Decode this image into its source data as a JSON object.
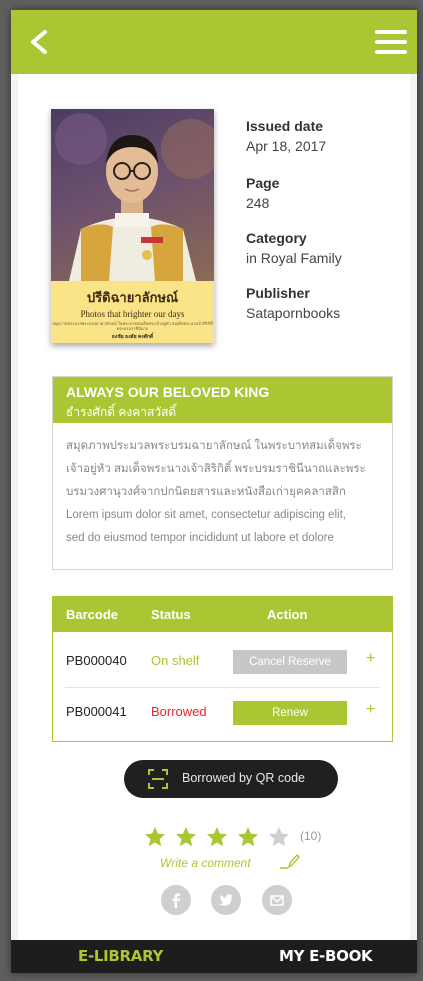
{
  "header": {
    "back_icon": "chevron-left-icon",
    "menu_icon": "hamburger-menu-icon",
    "accent_color": "#aac733"
  },
  "book": {
    "cover": {
      "title": "ปรีดิฉายาลักษณ์",
      "subtitle": "Photos that brighter our days",
      "small_text": "สมุดภาพประมวลพระบรมฉายาลักษณ์ ในพระบาทสมเด็จพระเจ้าอยู่หัว สมเด็จพระนางเจ้าสิริกิติ์ พระบรมราชินีนาถ",
      "author": "ธงชัย ธงสัย คงศักดิ์"
    },
    "meta": [
      {
        "label": "Issued date",
        "value": "Apr 18, 2017"
      },
      {
        "label": "Page",
        "value": "248"
      },
      {
        "label": "Category",
        "value": "in Royal Family"
      },
      {
        "label": "Publisher",
        "value": "Satapornbooks"
      }
    ]
  },
  "description": {
    "title": "ALWAYS OUR BELOVED KING",
    "author": "ธำรงศักดิ์ คงคาสวัสดิ์",
    "lines": [
      "สมุดภาพประมวลพระบรมฉายาลักษณ์ ในพระบาทสมเด็จพระ",
      "เจ้าอยู่หัว  สมเด็จพระนางเจ้าสิริกิติ์ พระบรมราชินีนาถและพระ",
      "บรมวงศานุวงศ์จากปกนิตยสารและหนังสือเก่ายุคคลาสสิก",
      "Lorem ipsum dolor sit amet, consectetur adipiscing elit,",
      "sed do eiusmod tempor incididunt ut labore et dolore"
    ]
  },
  "copies": {
    "headers": {
      "barcode": "Barcode",
      "status": "Status",
      "action": "Action"
    },
    "rows": [
      {
        "barcode": "PB000040",
        "status": "On shelf",
        "status_color": "#aac733",
        "action": "Cancel  Reserve",
        "action_color": "#c7c7c7",
        "plus": "+"
      },
      {
        "barcode": "PB000041",
        "status": "Borrowed",
        "status_color": "#e8262d",
        "action": "Renew",
        "action_color": "#aac733",
        "plus": "+"
      }
    ]
  },
  "qr": {
    "label": "Borrowed by QR code",
    "icon": "qr-scan-icon"
  },
  "rating": {
    "stars_filled": 4,
    "stars_total": 5,
    "count": "(10)",
    "comment": "Write a comment",
    "filled_color": "#aac733",
    "empty_color": "#cfcfcf"
  },
  "social": [
    "facebook-icon",
    "twitter-icon",
    "email-icon"
  ],
  "bottom_nav": {
    "library": {
      "label": "E-LIBRARY",
      "color": "#aac733"
    },
    "my_ebook": {
      "label": "MY E-BOOK",
      "color": "#ffffff"
    }
  }
}
